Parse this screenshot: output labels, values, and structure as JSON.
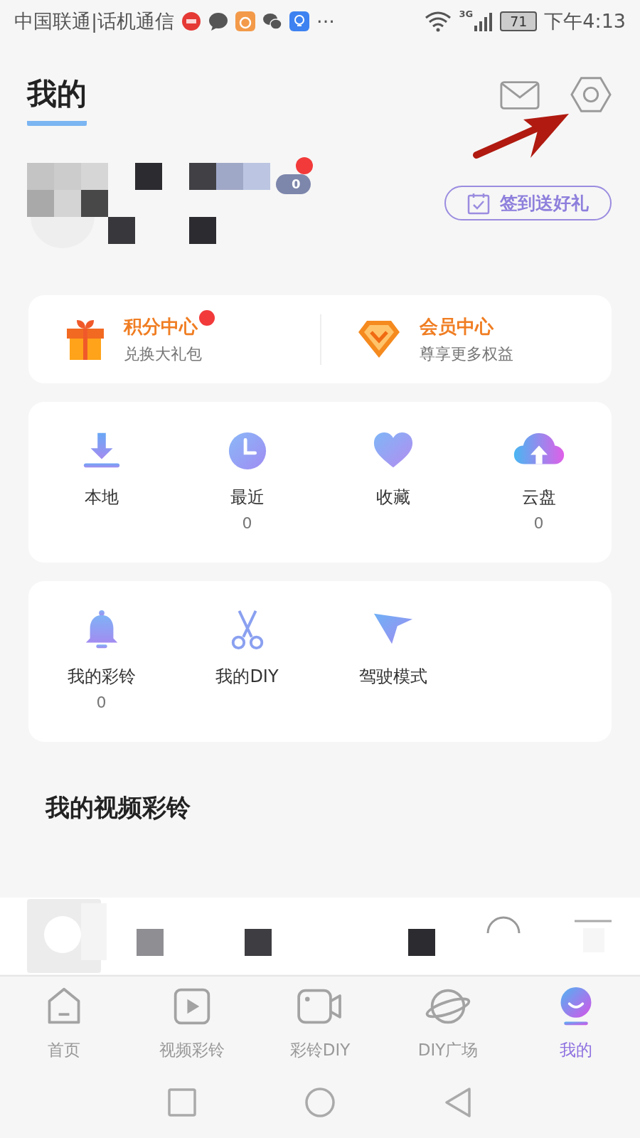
{
  "status_bar": {
    "carrier": "中国联通|话机通信",
    "more": "···",
    "network": "3G",
    "battery": "71",
    "time": "下午4:13"
  },
  "header": {
    "title": "我的"
  },
  "sign_in_button": {
    "label": "签到送好礼"
  },
  "profile": {
    "badge_dot": true,
    "badge_count": "0"
  },
  "benefits": [
    {
      "kind": "gift",
      "title": "积分中心",
      "subtitle": "兑换大礼包",
      "dot": true
    },
    {
      "kind": "vip",
      "title": "会员中心",
      "subtitle": "尊享更多权益",
      "dot": false
    }
  ],
  "library": [
    {
      "kind": "download",
      "label": "本地"
    },
    {
      "kind": "clock",
      "label": "最近",
      "count": "0"
    },
    {
      "kind": "heart",
      "label": "收藏"
    },
    {
      "kind": "cloud",
      "label": "云盘",
      "count": "0"
    }
  ],
  "tools": [
    {
      "kind": "bell",
      "label": "我的彩铃",
      "count": "0"
    },
    {
      "kind": "scissors",
      "label": "我的DIY"
    },
    {
      "kind": "plane",
      "label": "驾驶模式"
    }
  ],
  "section": {
    "title": "我的视频彩铃"
  },
  "tab_bar": [
    {
      "kind": "home",
      "label": "首页",
      "selected": false
    },
    {
      "kind": "play",
      "label": "视频彩铃",
      "selected": false
    },
    {
      "kind": "camera",
      "label": "彩铃DIY",
      "selected": false
    },
    {
      "kind": "planet",
      "label": "DIY广场",
      "selected": false
    },
    {
      "kind": "me",
      "label": "我的",
      "selected": true
    }
  ]
}
